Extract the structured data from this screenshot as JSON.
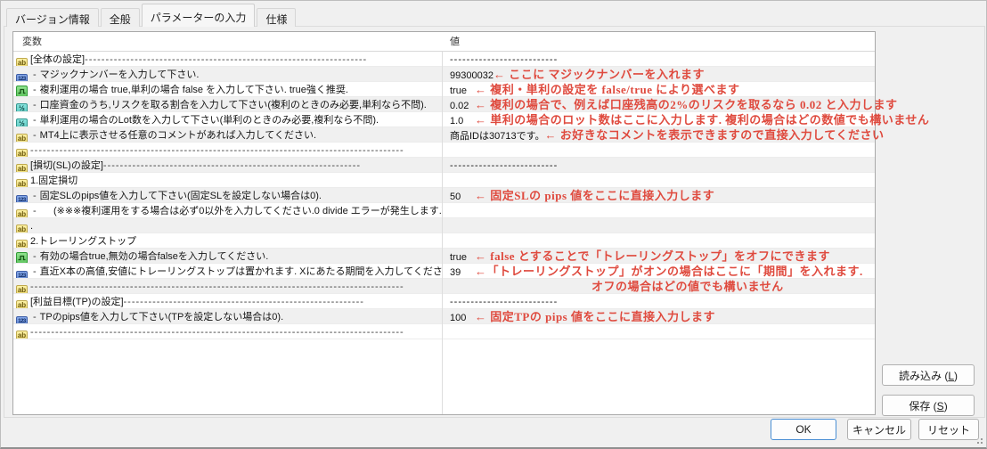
{
  "tabs": [
    {
      "label": "バージョン情報",
      "active": false
    },
    {
      "label": "全般",
      "active": false
    },
    {
      "label": "パラメーターの入力",
      "active": true
    },
    {
      "label": "仕様",
      "active": false
    }
  ],
  "table": {
    "columns": [
      "変数",
      "値"
    ],
    "rows": [
      {
        "icon": "string",
        "sep": false,
        "label": "[全体の設定]",
        "trail": "--------------------------------------------------------------------",
        "value": "--------------------------"
      },
      {
        "icon": "integer",
        "sep": true,
        "label": "マジックナンバーを入力して下さい.",
        "value": "99300032",
        "note": "← ここに マジックナンバーを入れます"
      },
      {
        "icon": "boolean",
        "sep": true,
        "label": "複利運用の場合 true,単利の場合 false を入力して下さい. true強く推奨.",
        "value": "true",
        "note": "← 複利・単利の設定を false/true により選べます"
      },
      {
        "icon": "double",
        "sep": true,
        "label": "口座資金のうち,リスクを取る割合を入力して下さい(複利のときのみ必要,単利なら不問).",
        "value": "0.02",
        "note": "← 複利の場合で、例えば口座残高の2%のリスクを取るなら 0.02 と入力します"
      },
      {
        "icon": "double",
        "sep": true,
        "label": "単利運用の場合のLot数を入力して下さい(単利のときのみ必要,複利なら不問).",
        "value": "1.0",
        "note": "← 単利の場合のロット数はここに入力します. 複利の場合はどの数値でも構いません"
      },
      {
        "icon": "string",
        "sep": true,
        "label": "MT4上に表示させる任意のコメントがあれば入力してください.",
        "value": "商品IDは30713です。",
        "note": "← お好きなコメントを表示できますので直接入力してください"
      },
      {
        "icon": "string",
        "sep": false,
        "trail": "------------------------------------------------------------------------------------------"
      },
      {
        "icon": "string",
        "sep": false,
        "label": "[損切(SL)の設定]",
        "trail": "--------------------------------------------------------------",
        "value": "--------------------------"
      },
      {
        "icon": "string",
        "sep": false,
        "label": "1.固定損切"
      },
      {
        "icon": "integer",
        "sep": true,
        "label": "固定SLのpips値を入力して下さい(固定SLを設定しない場合は0).",
        "value": "50",
        "note": "← 固定SLの pips 値をここに直接入力します"
      },
      {
        "icon": "string",
        "sep": true,
        "label": "     (※※※複利運用をする場合は必ず0以外を入力してください.0 divide エラーが発生します.)"
      },
      {
        "icon": "string",
        "sep": false,
        "label": "."
      },
      {
        "icon": "string",
        "sep": false,
        "label": "2.トレーリングストップ"
      },
      {
        "icon": "boolean",
        "sep": true,
        "label": "有効の場合true,無効の場合falseを入力してください.",
        "value": "true",
        "note": "← false とすることで「トレーリングストップ」をオフにできます"
      },
      {
        "icon": "integer",
        "sep": true,
        "label": "直近X本の高値,安値にトレーリングストップは置かれます. Xにあたる期間を入力してください(無効なら不問).",
        "value": "39",
        "note": "←「トレーリングストップ」がオンの場合はここに「期間」を入れます."
      },
      {
        "icon": "string",
        "sep": false,
        "trail": "------------------------------------------------------------------------------------------",
        "note2": "オフの場合はどの値でも構いません"
      },
      {
        "icon": "string",
        "sep": false,
        "label": "[利益目標(TP)の設定]",
        "trail": "----------------------------------------------------------",
        "value": "--------------------------"
      },
      {
        "icon": "integer",
        "sep": true,
        "label": "TPのpips値を入力して下さい(TPを設定しない場合は0).",
        "value": "100",
        "note": "← 固定TPの pips 値をここに直接入力します"
      },
      {
        "icon": "string",
        "sep": false,
        "trail": "------------------------------------------------------------------------------------------"
      }
    ]
  },
  "icon_glyphs": {
    "string": "ab",
    "integer": "123",
    "double": "½",
    "boolean": "square-wave"
  },
  "side_buttons": [
    {
      "text": "読み込み",
      "key": "L"
    },
    {
      "text": "保存",
      "key": "S"
    }
  ],
  "footer_buttons": [
    {
      "text": "OK",
      "primary": true
    },
    {
      "text": "キャンセル",
      "primary": false
    },
    {
      "text": "リセット",
      "primary": false
    }
  ],
  "colors": {
    "annotation_red": "#df4a3e",
    "default_button_border": "#4a8fd4",
    "row_shade": "#f0f0f0"
  }
}
